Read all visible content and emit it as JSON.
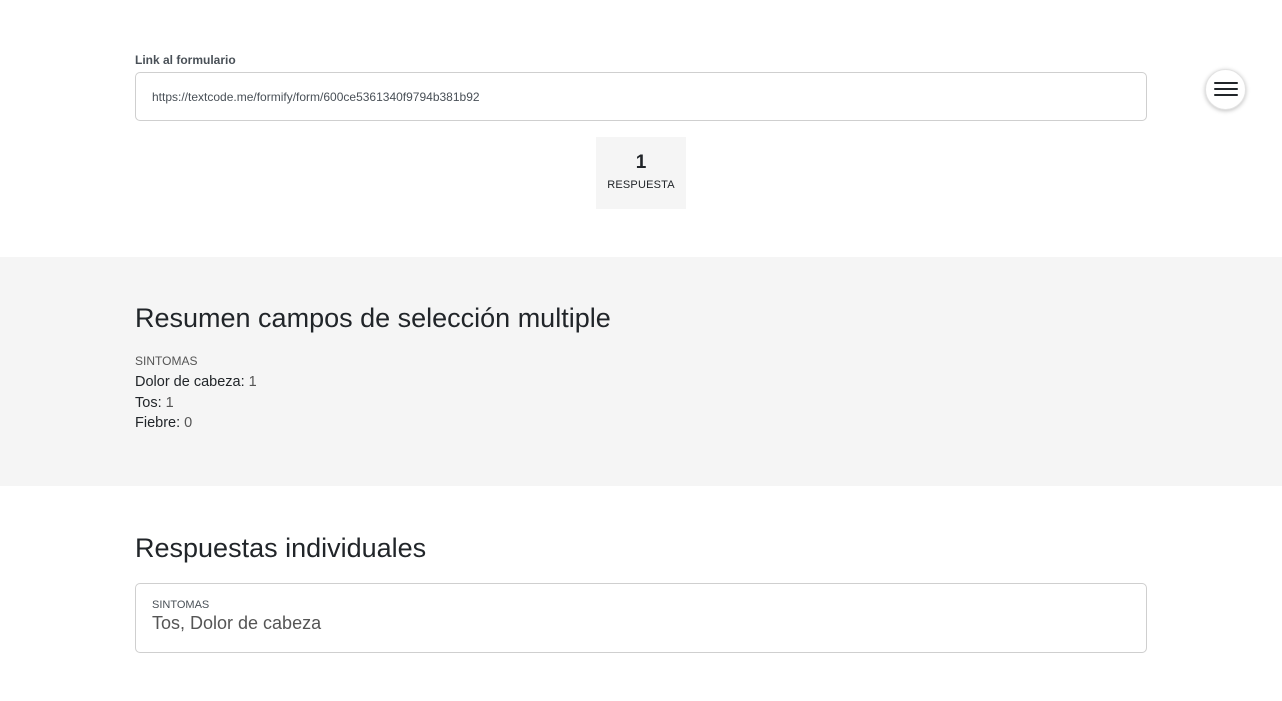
{
  "link": {
    "label": "Link al formulario",
    "url": "https://textcode.me/formify/form/600ce5361340f9794b381b92"
  },
  "menu": {
    "icon": "hamburger-icon"
  },
  "stats": {
    "count": "1",
    "label": "RESPUESTA"
  },
  "summary": {
    "title": "Resumen campos de selección multiple",
    "field_label": "SINTOMAS",
    "options": [
      {
        "name": "Dolor de cabeza:",
        "count": "1"
      },
      {
        "name": "Tos:",
        "count": "1"
      },
      {
        "name": "Fiebre:",
        "count": "0"
      }
    ]
  },
  "individual": {
    "title": "Respuestas individuales",
    "responses": [
      {
        "field_label": "SINTOMAS",
        "value": "Tos, Dolor de cabeza"
      }
    ]
  }
}
